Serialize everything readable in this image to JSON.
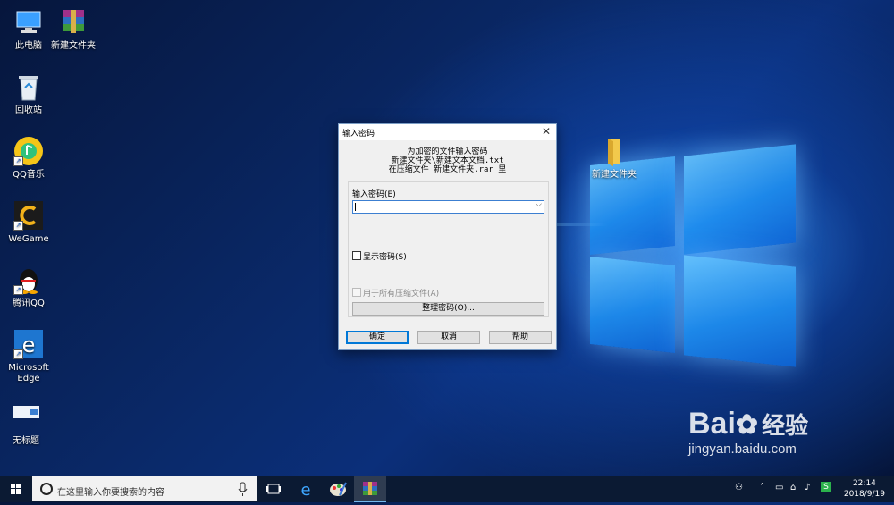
{
  "desktop": {
    "icons": [
      {
        "label": "此电脑"
      },
      {
        "label": "新建文件夹"
      },
      {
        "label": "回收站"
      },
      {
        "label": "QQ音乐"
      },
      {
        "label": "WeGame"
      },
      {
        "label": "腾讯QQ"
      },
      {
        "label": "Microsoft Edge"
      },
      {
        "label": "无标题"
      },
      {
        "label": "新建文件夹"
      }
    ]
  },
  "dialog": {
    "title": "输入密码",
    "info_line1": "为加密的文件输入密码",
    "info_line2": "新建文件夹\\新建文本文档.txt",
    "info_line3": "在压缩文件 新建文件夹.rar 里",
    "password_label": "输入密码(E)",
    "password_value": "",
    "show_password_label": "显示密码(S)",
    "use_for_all_label": "用于所有压缩文件(A)",
    "organize_button": "整理密码(O)...",
    "ok_button": "确定",
    "cancel_button": "取消",
    "help_button": "帮助"
  },
  "taskbar": {
    "search_placeholder": "在这里输入你要搜索的内容",
    "time": "22:14",
    "date": "2018/9/19"
  },
  "watermark": {
    "brand": "Bai",
    "brand_cn": "经验",
    "url": "jingyan.baidu.com"
  }
}
